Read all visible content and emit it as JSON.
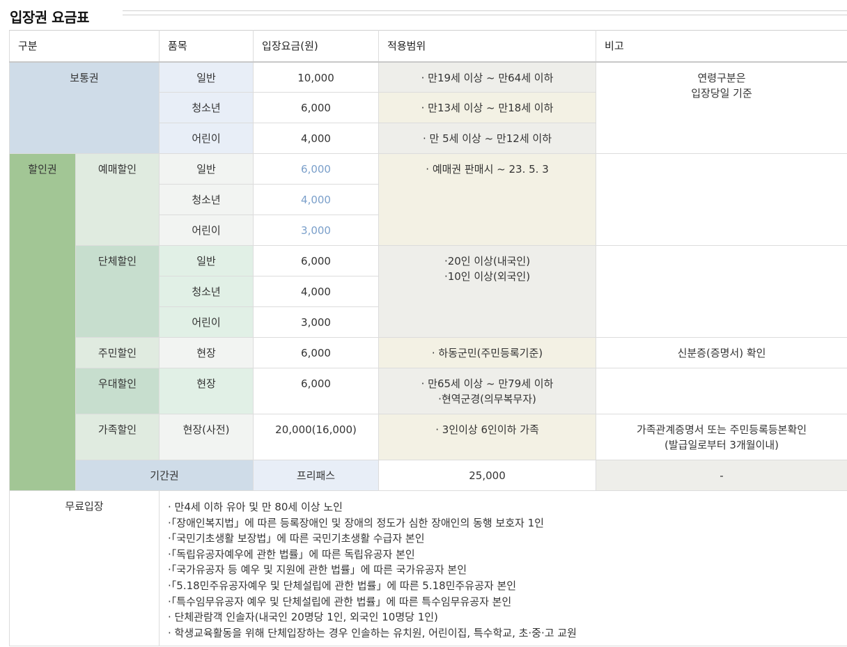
{
  "page_title": "입장권 요금표",
  "headers": [
    "구분",
    "품목",
    "입장요금(원)",
    "적용범위",
    "비고"
  ],
  "regular": {
    "category": "보통권",
    "items": [
      {
        "item": "일반",
        "price": "10,000",
        "scope": "· 만19세 이상 ~ 만64세 이하"
      },
      {
        "item": "청소년",
        "price": "6,000",
        "scope": "· 만13세 이상 ~ 만18세 이하"
      },
      {
        "item": "어린이",
        "price": "4,000",
        "scope": "· 만 5세 이상 ~ 만12세 이하"
      }
    ],
    "note_lines": [
      "연령구분은",
      "입장당일 기준"
    ]
  },
  "discount": {
    "category": "할인권",
    "advance": {
      "label": "예매할인",
      "items": [
        {
          "item": "일반",
          "price": "6,000"
        },
        {
          "item": "청소년",
          "price": "4,000"
        },
        {
          "item": "어린이",
          "price": "3,000"
        }
      ],
      "scope": "· 예매권 판매시 ~ 23. 5. 3",
      "price_color": "#7a9fca"
    },
    "group": {
      "label": "단체할인",
      "items": [
        {
          "item": "일반",
          "price": "6,000"
        },
        {
          "item": "청소년",
          "price": "4,000"
        },
        {
          "item": "어린이",
          "price": "3,000"
        }
      ],
      "scope_lines": [
        "·20인 이상(내국인)",
        "·10인 이상(외국인)"
      ]
    },
    "resident": {
      "label": "주민할인",
      "item": "현장",
      "price": "6,000",
      "scope": "· 하동군민(주민등록기준)",
      "note": "신분증(증명서) 확인"
    },
    "preferential": {
      "label": "우대할인",
      "item": "현장",
      "price": "6,000",
      "scope_lines": [
        "· 만65세 이상 ~ 만79세 이하",
        "·현역군경(의무복무자)"
      ]
    },
    "family": {
      "label": "가족할인",
      "item": "현장(사전)",
      "price": "20,000(16,000)",
      "scope": "· 3인이상 6인이하 가족",
      "note_lines": [
        "가족관계증명서 또는 주민등록등본확인",
        "(발급일로부터 3개월이내)"
      ]
    }
  },
  "season": {
    "category": "기간권",
    "item": "프리패스",
    "price": "25,000",
    "scope": "-"
  },
  "free": {
    "category": "무료입장",
    "lines": [
      "· 만4세 이하 유아 및 만 80세 이상 노인",
      "·「장애인복지법」에 따른 등록장애인 및 장애의 정도가 심한 장애인의 동행 보호자 1인",
      "·「국민기초생활 보장법」에 따른 국민기초생활 수급자 본인",
      "·「독립유공자예우에 관한 법률」에 따른 독립유공자 본인",
      "·「국가유공자 등 예우 및 지원에 관한 법률」에 따른 국가유공자 본인",
      "·「5.18민주유공자예우 및 단체설립에 관한 법률」에 따른 5.18민주유공자 본인",
      "·「특수임무유공자 예우 및 단체설립에 관한 법률」에 따른 특수임무유공자 본인",
      "· 단체관람객 인솔자(내국인 20명당 1인, 외국인 10명당 1인)",
      "· 학생교육활동을 위해 단체입장하는 경우 인솔하는 유치원, 어린이집, 특수학교, 초·중·고 교원"
    ]
  }
}
